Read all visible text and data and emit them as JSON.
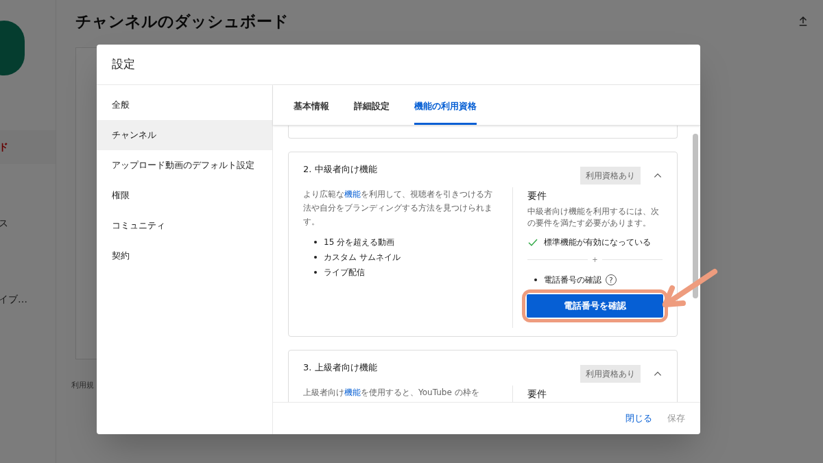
{
  "page": {
    "title": "チャンネルのダッシュボード",
    "sidebar_fragments": [
      {
        "text": "ド",
        "selected": true
      },
      {
        "text": "ス",
        "selected": false
      },
      {
        "text": "イブ…",
        "selected": false
      }
    ],
    "footer_fragment": "利用規"
  },
  "dialog": {
    "title": "設定",
    "nav": [
      {
        "label": "全般",
        "selected": false
      },
      {
        "label": "チャンネル",
        "selected": true
      },
      {
        "label": "アップロード動画のデフォルト設定",
        "selected": false
      },
      {
        "label": "権限",
        "selected": false
      },
      {
        "label": "コミュニティ",
        "selected": false
      },
      {
        "label": "契約",
        "selected": false
      }
    ],
    "tabs": [
      {
        "label": "基本情報",
        "selected": false
      },
      {
        "label": "詳細設定",
        "selected": false
      },
      {
        "label": "機能の利用資格",
        "selected": true
      }
    ],
    "sections": [
      {
        "title": "2. 中級者向け機能",
        "badge": "利用資格あり",
        "expanded": true,
        "description": {
          "before": "より広範な",
          "link": "機能",
          "after": "を利用して、視聴者を引きつける方法や自分をブランディングする方法を見つけられます。"
        },
        "features": [
          "15 分を超える動画",
          "カスタム サムネイル",
          "ライブ配信"
        ],
        "requirements": {
          "heading": "要件",
          "note": "中級者向け機能を利用するには、次の要件を満たす必要があります。",
          "met": [
            {
              "text": "標準機能が有効になっている",
              "checked": true
            }
          ],
          "separator": "+",
          "pending": [
            {
              "text": "電話番号の確認",
              "help": "?"
            }
          ],
          "button": "電話番号を確認",
          "highlighted": true
        }
      },
      {
        "title": "3. 上級者向け機能",
        "badge": "利用資格あり",
        "expanded": true,
        "description": {
          "before": "上級者向け",
          "link": "機能",
          "after": "を使用すると、YouTube の枠を"
        },
        "requirements": {
          "heading": "要件"
        }
      }
    ],
    "buttons": [
      {
        "label": "閉じる",
        "disabled": false
      },
      {
        "label": "保存",
        "disabled": true
      }
    ]
  }
}
